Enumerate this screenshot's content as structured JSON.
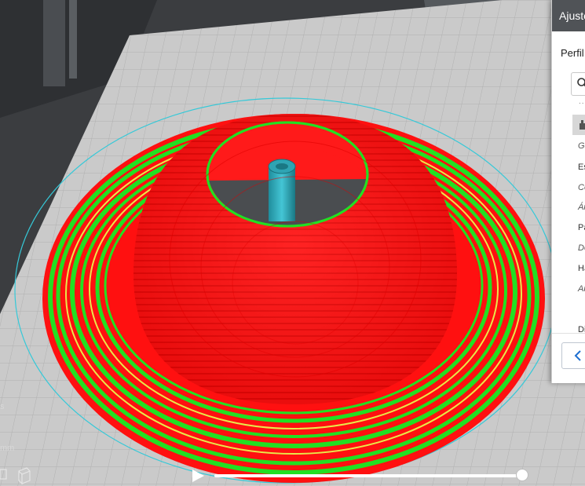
{
  "panel": {
    "title": "Ajustes de impresión",
    "profile_label": "Perfil",
    "ellipsis": "....",
    "settings": [
      "Ge",
      "Es",
      "Co",
      "Ár",
      "Pa",
      "De",
      "Ha",
      "Ar",
      "Di"
    ]
  },
  "overlay": {
    "left_label_s": "s",
    "left_label_mm": "mm"
  },
  "layer_view": {
    "progress": 1.0
  },
  "icons": {
    "search": "search-icon",
    "category": "category-icon",
    "back": "chevron-left-icon",
    "play": "play-icon",
    "view_cube": "view-cube-icon"
  },
  "colors": {
    "shell": "#ff1010",
    "skin": "#22e022",
    "support": "#e8e84a",
    "travel": "#2ab7c7",
    "build_plate": "#c9c9c9",
    "panel_header": "#505357",
    "accent": "#1e6fd1"
  }
}
